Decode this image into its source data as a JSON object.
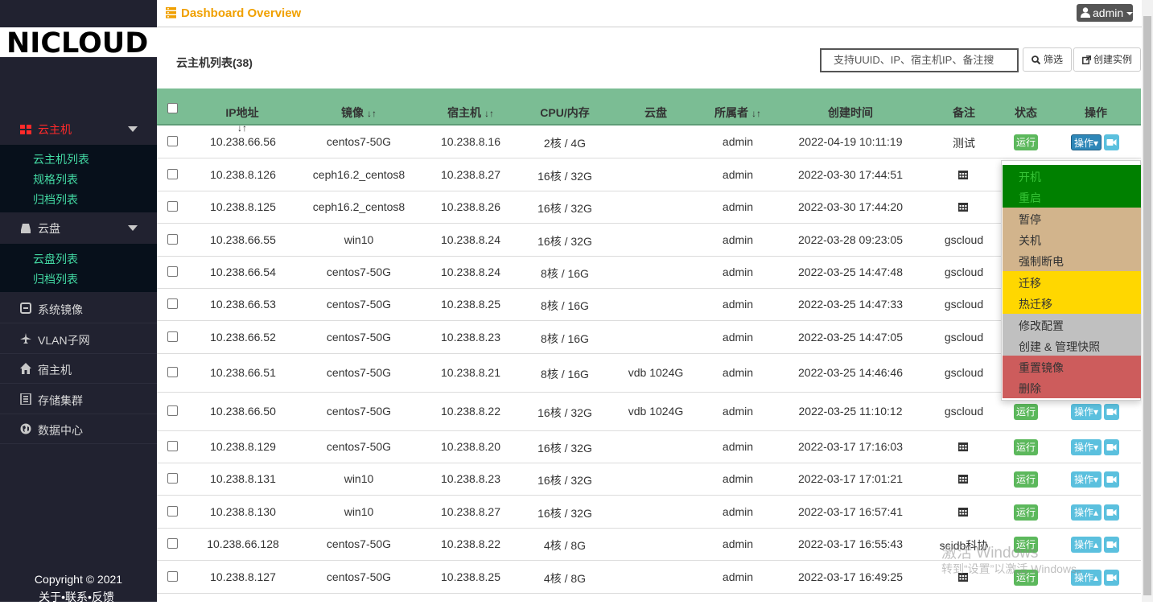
{
  "brand": {
    "logo_text": "NICLOUD"
  },
  "sidebar": {
    "groups": [
      {
        "label": "云主机",
        "items": [
          "云主机列表",
          "规格列表",
          "归档列表"
        ]
      },
      {
        "label": "云盘",
        "items": [
          "云盘列表",
          "归档列表"
        ]
      }
    ],
    "links": [
      "系统镜像",
      "VLAN子网",
      "宿主机",
      "存储集群",
      "数据中心"
    ],
    "copyright": "Copyright © 2021",
    "footer_links": "关于•联系•反馈"
  },
  "topbar": {
    "title": "Dashboard Overview",
    "user": "admin"
  },
  "main": {
    "list_title": "云主机列表(38)",
    "search_placeholder": "支持UUID、IP、宿主机IP、备注搜",
    "filter_label": "筛选",
    "create_label": "创建实例"
  },
  "table": {
    "columns": [
      "IP地址",
      "镜像",
      "宿主机",
      "CPU/内存",
      "云盘",
      "所属者",
      "创建时间",
      "备注",
      "状态",
      "操作"
    ],
    "rows": [
      {
        "ip": "10.238.66.56",
        "image": "centos7-50G",
        "host": "10.238.8.16",
        "spec": "2核 / 4G",
        "disk": "",
        "owner": "admin",
        "created": "2022-04-19 10:11:19",
        "note": "测试",
        "status": "运行",
        "op": "操作▾"
      },
      {
        "ip": "10.238.8.126",
        "image": "ceph16.2_centos8",
        "host": "10.238.8.27",
        "spec": "16核 / 32G",
        "disk": "",
        "owner": "admin",
        "created": "2022-03-30 17:44:51",
        "note": "",
        "status": "",
        "op": ""
      },
      {
        "ip": "10.238.8.125",
        "image": "ceph16.2_centos8",
        "host": "10.238.8.26",
        "spec": "16核 / 32G",
        "disk": "",
        "owner": "admin",
        "created": "2022-03-30 17:44:20",
        "note": "",
        "status": "",
        "op": ""
      },
      {
        "ip": "10.238.66.55",
        "image": "win10",
        "host": "10.238.8.24",
        "spec": "16核 / 32G",
        "disk": "",
        "owner": "admin",
        "created": "2022-03-28 09:23:05",
        "note": "gscloud",
        "status": "",
        "op": ""
      },
      {
        "ip": "10.238.66.54",
        "image": "centos7-50G",
        "host": "10.238.8.24",
        "spec": "8核 / 16G",
        "disk": "",
        "owner": "admin",
        "created": "2022-03-25 14:47:48",
        "note": "gscloud",
        "status": "",
        "op": ""
      },
      {
        "ip": "10.238.66.53",
        "image": "centos7-50G",
        "host": "10.238.8.25",
        "spec": "8核 / 16G",
        "disk": "",
        "owner": "admin",
        "created": "2022-03-25 14:47:33",
        "note": "gscloud",
        "status": "",
        "op": ""
      },
      {
        "ip": "10.238.66.52",
        "image": "centos7-50G",
        "host": "10.238.8.23",
        "spec": "8核 / 16G",
        "disk": "",
        "owner": "admin",
        "created": "2022-03-25 14:47:05",
        "note": "gscloud",
        "status": "",
        "op": ""
      },
      {
        "ip": "10.238.66.51",
        "image": "centos7-50G",
        "host": "10.238.8.21",
        "spec": "8核 / 16G",
        "disk": "vdb 1024G",
        "owner": "admin",
        "created": "2022-03-25 14:46:46",
        "note": "gscloud",
        "status": "",
        "op": ""
      },
      {
        "ip": "10.238.66.50",
        "image": "centos7-50G",
        "host": "10.238.8.22",
        "spec": "16核 / 32G",
        "disk": "vdb 1024G",
        "owner": "admin",
        "created": "2022-03-25 11:10:12",
        "note": "gscloud",
        "status": "运行",
        "op": "操作▾"
      },
      {
        "ip": "10.238.8.129",
        "image": "centos7-50G",
        "host": "10.238.8.20",
        "spec": "16核 / 32G",
        "disk": "",
        "owner": "admin",
        "created": "2022-03-17 17:16:03",
        "note": "",
        "status": "运行",
        "op": "操作▾"
      },
      {
        "ip": "10.238.8.131",
        "image": "win10",
        "host": "10.238.8.23",
        "spec": "16核 / 32G",
        "disk": "",
        "owner": "admin",
        "created": "2022-03-17 17:01:21",
        "note": "",
        "status": "运行",
        "op": "操作▾"
      },
      {
        "ip": "10.238.8.130",
        "image": "win10",
        "host": "10.238.8.27",
        "spec": "16核 / 32G",
        "disk": "",
        "owner": "admin",
        "created": "2022-03-17 16:57:41",
        "note": "",
        "status": "运行",
        "op": "操作▴"
      },
      {
        "ip": "10.238.66.128",
        "image": "centos7-50G",
        "host": "10.238.8.22",
        "spec": "4核 / 8G",
        "disk": "",
        "owner": "admin",
        "created": "2022-03-17 16:55:43",
        "note": "scidb科协",
        "status": "运行",
        "op": "操作▴"
      },
      {
        "ip": "10.238.8.127",
        "image": "centos7-50G",
        "host": "10.238.8.25",
        "spec": "4核 / 8G",
        "disk": "",
        "owner": "admin",
        "created": "2022-03-17 16:49:25",
        "note": "",
        "status": "运行",
        "op": "操作▴"
      }
    ]
  },
  "dropdown": {
    "sections": [
      {
        "color": "#008000",
        "text_color": "#36c336",
        "items": [
          "开机",
          "重启"
        ]
      },
      {
        "color": "#d2b48c",
        "text_color": "#333333",
        "items": [
          "暂停",
          "关机",
          "强制断电"
        ]
      },
      {
        "color": "#ffd700",
        "text_color": "#333333",
        "items": [
          "迁移",
          "热迁移"
        ]
      },
      {
        "color": "#c0c0c0",
        "text_color": "#333333",
        "items": [
          "修改配置",
          "创建 & 管理快照"
        ]
      },
      {
        "color": "#cd5c5c",
        "text_color": "#333333",
        "items": [
          "重置镜像",
          "删除"
        ]
      }
    ]
  },
  "watermark": {
    "line1": "激活 Windows",
    "line2": "转到“设置”以激活 Windows。"
  },
  "colors": {
    "accent": "#f0a000",
    "sidebar_bg": "#212230",
    "active_nav": "#ff2a2a",
    "sub_nav_text": "#43d9a3",
    "table_header": "#7bbd94",
    "status_green": "#5cb85c",
    "op_blue": "#5bc0de"
  }
}
